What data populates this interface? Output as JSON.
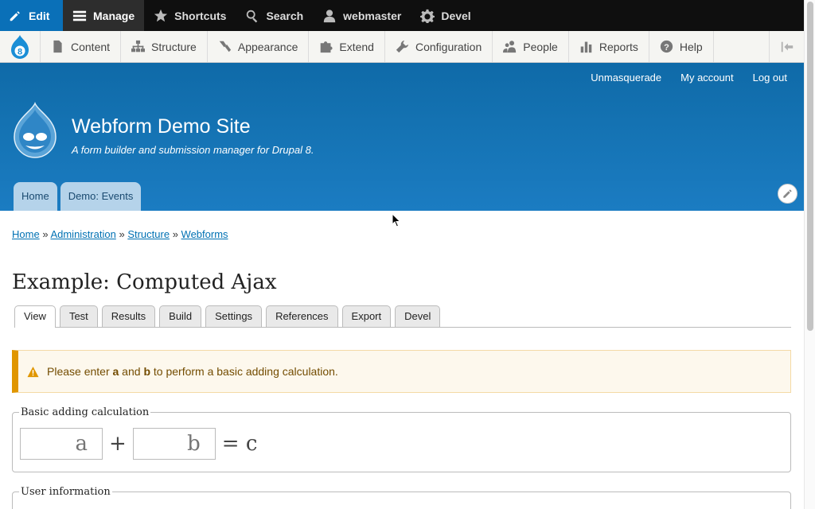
{
  "toolbar": {
    "edit_label": "Edit",
    "manage_label": "Manage",
    "shortcuts_label": "Shortcuts",
    "search_label": "Search",
    "user_label": "webmaster",
    "devel_label": "Devel"
  },
  "admin_menu": [
    {
      "label": "Content",
      "icon": "document-icon"
    },
    {
      "label": "Structure",
      "icon": "sitemap-icon"
    },
    {
      "label": "Appearance",
      "icon": "paintbrush-icon"
    },
    {
      "label": "Extend",
      "icon": "puzzle-icon"
    },
    {
      "label": "Configuration",
      "icon": "wrench-icon"
    },
    {
      "label": "People",
      "icon": "people-icon"
    },
    {
      "label": "Reports",
      "icon": "bar-chart-icon"
    },
    {
      "label": "Help",
      "icon": "help-icon"
    }
  ],
  "header": {
    "secondary_menu": [
      "Unmasquerade",
      "My account",
      "Log out"
    ],
    "site_name": "Webform Demo Site",
    "site_slogan": "A form builder and submission manager for Drupal 8.",
    "primary_tabs": [
      "Home",
      "Demo: Events"
    ]
  },
  "breadcrumb": {
    "items": [
      "Home",
      "Administration",
      "Structure",
      "Webforms"
    ],
    "separator": "»"
  },
  "page_title": "Example: Computed Ajax",
  "tabs": [
    "View",
    "Test",
    "Results",
    "Build",
    "Settings",
    "References",
    "Export",
    "Devel"
  ],
  "alert": {
    "pre": "Please enter ",
    "a": "a",
    "mid": " and ",
    "b": "b",
    "post": " to perform a basic adding calculation."
  },
  "form": {
    "fieldset1_legend": "Basic adding calculation",
    "input_a_placeholder": "a",
    "plus": "+",
    "input_b_placeholder": "b",
    "equals": "= c",
    "fieldset2_legend": "User information"
  },
  "colors": {
    "brand_blue": "#0a70b8",
    "header_blue": "#1472b2",
    "link": "#0071b3",
    "warning": "#e09600"
  }
}
